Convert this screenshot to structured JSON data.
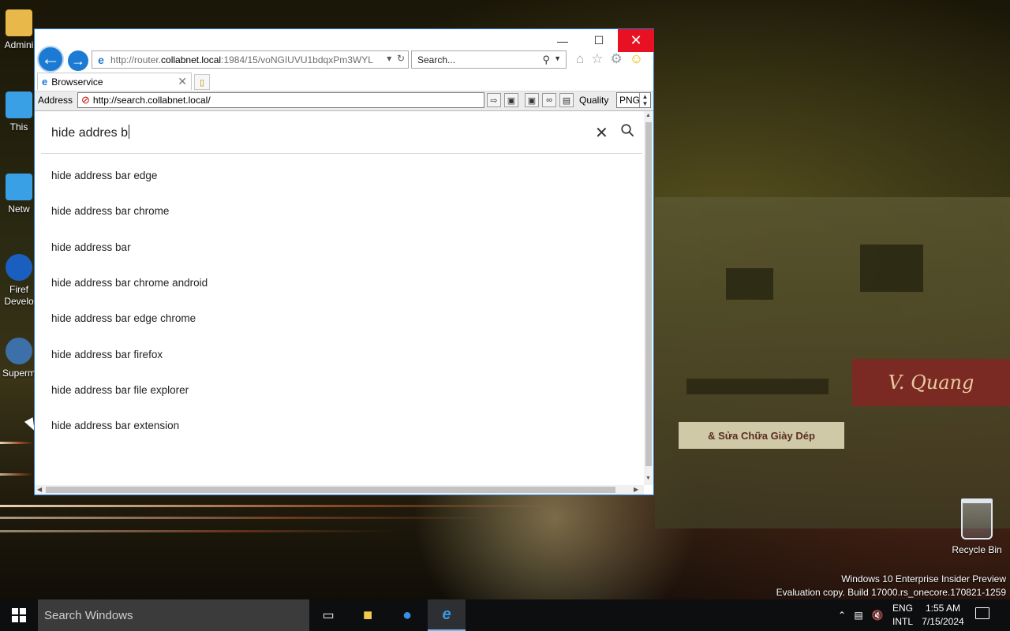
{
  "desktop": {
    "icons": [
      {
        "label": "Admini"
      },
      {
        "label": "This"
      },
      {
        "label": "Netw"
      },
      {
        "label": "Firef\nDevelo"
      },
      {
        "label": "Superm"
      }
    ],
    "recycle_bin": "Recycle Bin",
    "wallpaper_sign": "V. Quang",
    "wallpaper_sign2": "& Sửa Chữa Giày Dép",
    "watermark_line1": "Windows 10 Enterprise Insider Preview",
    "watermark_line2": "Evaluation copy. Build 17000.rs_onecore.170821-1259"
  },
  "browser": {
    "url_prefix": "http://router.",
    "url_domain": "collabnet.local",
    "url_suffix": ":1984/15/voNGIUVU1bdqxPm3WYL",
    "search_placeholder": "Search...",
    "tab_title": "Browservice",
    "address_label": "Address",
    "address_value": "http://search.collabnet.local/",
    "quality_label": "Quality",
    "format_value": "PNG",
    "colors": {
      "accent": "#1b7ad3",
      "close": "#e81123"
    }
  },
  "page": {
    "query": "hide addres b",
    "suggestions": [
      "hide address bar edge",
      "hide address bar chrome",
      "hide address bar",
      "hide address bar chrome android",
      "hide address bar edge chrome",
      "hide address bar firefox",
      "hide address bar file explorer",
      "hide address bar extension"
    ]
  },
  "taskbar": {
    "search_placeholder": "Search Windows",
    "lang_line1": "ENG",
    "lang_line2": "INTL",
    "time": "1:55 AM",
    "date": "7/15/2024"
  }
}
